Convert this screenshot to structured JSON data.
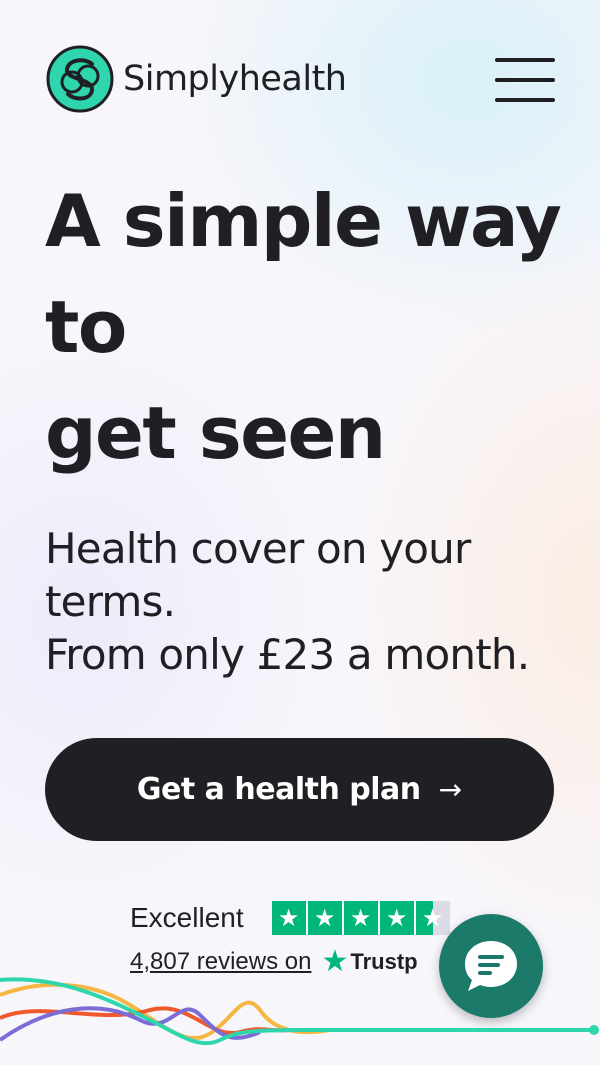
{
  "brand": {
    "name": "Simplyhealth",
    "accent": "#2fd6ad"
  },
  "header": {
    "menu_icon": "hamburger-menu-icon"
  },
  "hero": {
    "title_line1": "A simple way to",
    "title_line2": "get seen",
    "subtitle_line1": "Health cover on your terms.",
    "subtitle_line2": "From only £23 a month."
  },
  "cta": {
    "label": "Get a health plan",
    "arrow": "→",
    "color": "#1f1f24"
  },
  "trustpilot": {
    "rating_label": "Excellent",
    "stars": 4.5,
    "reviews_text": "4,807 reviews on",
    "brand": "Trustp",
    "star_color": "#00b67a"
  },
  "chat": {
    "icon": "chat-bubble-icon",
    "color": "#1c7a6a"
  }
}
